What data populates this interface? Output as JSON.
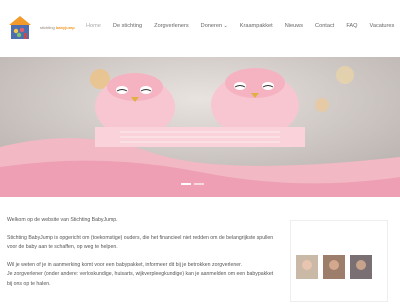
{
  "brand": {
    "prefix": "stichting",
    "name": "babyjump"
  },
  "nav": {
    "items": [
      {
        "label": "Home",
        "active": true
      },
      {
        "label": "De stichting",
        "active": false
      },
      {
        "label": "Zorgverleners",
        "active": false
      },
      {
        "label": "Doneren",
        "active": false,
        "dropdown": true
      },
      {
        "label": "Kraampakket",
        "active": false
      },
      {
        "label": "Nieuws",
        "active": false
      },
      {
        "label": "Contact",
        "active": false
      },
      {
        "label": "FAQ",
        "active": false
      },
      {
        "label": "Vacatures",
        "active": false
      }
    ]
  },
  "slider": {
    "slide_count": 2,
    "current": 1
  },
  "content": {
    "p1": "Welkom op de website van Stichting BabyJump.",
    "p2": "Stichting BabyJump is opgericht om (toekomstige) ouders, die het financieel niet redden om de belangrijkste spullen voor de baby aan te schaffen, op weg te helpen.",
    "p3a": "Wil je weten of je in aanmerking komt voor een babypakket, informeer dit bij je betrokken zorgverlener.",
    "p3b": "Je zorgverlener (onder andere: verloskundige, huisarts, wijkverpleegkundige) kan je aanmelden om een babypakket bij ons op te halen."
  },
  "colors": {
    "accent": "#f29b2b",
    "pink": "#f4a6b6"
  }
}
